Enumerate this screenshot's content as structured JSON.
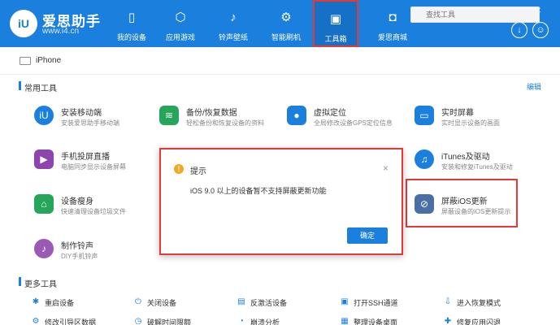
{
  "app": {
    "title": "爱思助手",
    "url": "www.i4.cn",
    "logo_text": "iU"
  },
  "nav": [
    {
      "label": "我的设备",
      "icon": "phone-icon",
      "glyph": "▯"
    },
    {
      "label": "应用游戏",
      "icon": "cube-icon",
      "glyph": "⬡"
    },
    {
      "label": "铃声壁纸",
      "icon": "music-file-icon",
      "glyph": "♪"
    },
    {
      "label": "智能刷机",
      "icon": "gear-icon",
      "glyph": "⚙"
    },
    {
      "label": "工具箱",
      "icon": "toolbox-icon",
      "glyph": "▣"
    },
    {
      "label": "爱思商城",
      "icon": "shopping-bag-icon",
      "glyph": "◘"
    }
  ],
  "window_controls": {
    "shirt": "⚇",
    "settings": "⚙",
    "minimize": "—",
    "maximize": "□",
    "close": "✕",
    "download": "↓",
    "user": "☺"
  },
  "device": {
    "name": "iPhone"
  },
  "search": {
    "placeholder": "查找工具"
  },
  "sections": {
    "common": "常用工具",
    "more": "更多工具",
    "edit": "编辑"
  },
  "tools": [
    {
      "name": "安装移动端",
      "desc": "安装爱思助手移动端",
      "icon": "i4-app-icon",
      "glyph": "iU",
      "color": "#1a7fdd"
    },
    {
      "name": "备份/恢复数据",
      "desc": "轻松备份和恢复设备的资料",
      "icon": "layers-icon",
      "glyph": "≋",
      "color": "#26a65b"
    },
    {
      "name": "虚拟定位",
      "desc": "全局修改设备GPS定位信息",
      "icon": "location-pin-icon",
      "glyph": "●",
      "color": "#1a7fdd"
    },
    {
      "name": "实时屏幕",
      "desc": "实时显示设备的画面",
      "icon": "screen-icon",
      "glyph": "▭",
      "color": "#1a7fdd"
    },
    {
      "name": "手机投屏直播",
      "desc": "电脑同步显示设备屏幕",
      "icon": "cast-icon",
      "glyph": "▶",
      "color": "#8e44ad"
    },
    {
      "name": "iTunes及驱动",
      "desc": "安装和修复iTunes及驱动",
      "icon": "itunes-icon",
      "glyph": "♫",
      "color": "#1a7fdd"
    },
    {
      "name": "设备瘦身",
      "desc": "快速清理设备垃圾文件",
      "icon": "broom-icon",
      "glyph": "⌂",
      "color": "#26a65b"
    },
    {
      "name": "屏蔽iOS更新",
      "desc": "屏蔽设备的iOS更新提示",
      "icon": "block-update-icon",
      "glyph": "⊘",
      "color": "#4a6fa5"
    },
    {
      "name": "制作铃声",
      "desc": "DIY手机铃声",
      "icon": "ringtone-icon",
      "glyph": "♪",
      "color": "#9b59b6"
    }
  ],
  "more_tools_row1": [
    {
      "name": "重启设备",
      "icon": "loading-icon",
      "glyph": "✱"
    },
    {
      "name": "关闭设备",
      "icon": "power-icon",
      "glyph": "⏻"
    },
    {
      "name": "反激活设备",
      "icon": "document-icon",
      "glyph": "▤"
    },
    {
      "name": "打开SSH通道",
      "icon": "terminal-icon",
      "glyph": "▣"
    },
    {
      "name": "进入恢复模式",
      "icon": "download-box-icon",
      "glyph": "⇩"
    }
  ],
  "more_tools_row2": [
    {
      "name": "修改引导区数据",
      "icon": "wrench-icon",
      "glyph": "⚙"
    },
    {
      "name": "破解时间限额",
      "icon": "clock-icon",
      "glyph": "◷"
    },
    {
      "name": "崩溃分析",
      "icon": "chart-icon",
      "glyph": "◔"
    },
    {
      "name": "整理设备桌面",
      "icon": "grid-icon",
      "glyph": "▦"
    },
    {
      "name": "修复应用闪退",
      "icon": "repair-icon",
      "glyph": "✚"
    }
  ],
  "dialog": {
    "title": "提示",
    "message": "iOS 9.0 以上的设备暂不支持屏蔽更新功能",
    "confirm": "确定",
    "close": "×",
    "warn_glyph": "!"
  },
  "colors": {
    "brand": "#1a7fdd",
    "highlight": "#e53935",
    "warning": "#f5a623"
  }
}
